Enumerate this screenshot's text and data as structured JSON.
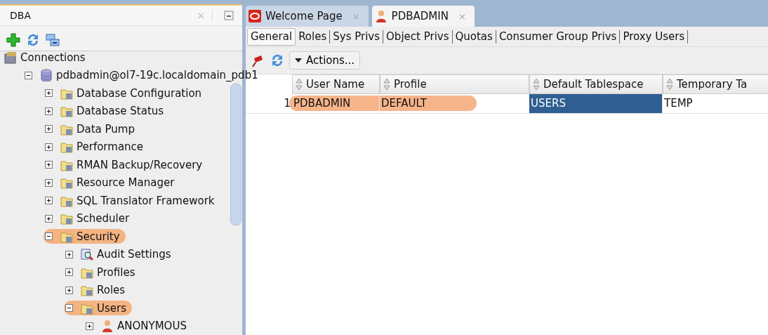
{
  "left_panel": {
    "title": "DBA",
    "close": "×",
    "tree": [
      {
        "label": "Connections",
        "kind": "connections",
        "children": [
          {
            "label": "pdbadmin@ol7-19c.localdomain_pdb1",
            "kind": "database",
            "expanded": true,
            "highlighted": false,
            "children": [
              {
                "label": "Database Configuration",
                "kind": "folder",
                "expanded": false,
                "highlighted": false
              },
              {
                "label": "Database Status",
                "kind": "folder",
                "expanded": false,
                "highlighted": false
              },
              {
                "label": "Data Pump",
                "kind": "folder",
                "expanded": false,
                "highlighted": false
              },
              {
                "label": "Performance",
                "kind": "folder",
                "expanded": false,
                "highlighted": false
              },
              {
                "label": "RMAN Backup/Recovery",
                "kind": "folder",
                "expanded": false,
                "highlighted": false
              },
              {
                "label": "Resource Manager",
                "kind": "folder",
                "expanded": false,
                "highlighted": false
              },
              {
                "label": "SQL Translator Framework",
                "kind": "folder",
                "expanded": false,
                "highlighted": false
              },
              {
                "label": "Scheduler",
                "kind": "folder",
                "expanded": false,
                "highlighted": false
              },
              {
                "label": "Security",
                "kind": "folder",
                "expanded": true,
                "highlighted": true,
                "children": [
                  {
                    "label": "Audit Settings",
                    "kind": "audit",
                    "expanded": false,
                    "highlighted": false
                  },
                  {
                    "label": "Profiles",
                    "kind": "folder",
                    "expanded": false,
                    "highlighted": false
                  },
                  {
                    "label": "Roles",
                    "kind": "folder",
                    "expanded": false,
                    "highlighted": false
                  },
                  {
                    "label": "Users",
                    "kind": "folder",
                    "expanded": true,
                    "highlighted": true,
                    "children": [
                      {
                        "label": "ANONYMOUS",
                        "kind": "user",
                        "expanded": false,
                        "highlighted": false
                      }
                    ]
                  }
                ]
              }
            ]
          }
        ]
      }
    ]
  },
  "editor": {
    "tabs": [
      {
        "label": "Welcome Page",
        "kind": "oracle",
        "close": "×",
        "selected": false
      },
      {
        "label": "PDBADMIN",
        "kind": "user",
        "close": "×",
        "selected": true
      }
    ],
    "subtabs": [
      {
        "label": "General",
        "selected": true
      },
      {
        "label": "Roles",
        "selected": false
      },
      {
        "label": "Sys Privs",
        "selected": false
      },
      {
        "label": "Object Privs",
        "selected": false
      },
      {
        "label": "Quotas",
        "selected": false
      },
      {
        "label": "Consumer Group Privs",
        "selected": false
      },
      {
        "label": "Proxy Users",
        "selected": false
      }
    ],
    "actions_button": "Actions...",
    "table": {
      "columns": [
        "User Name",
        "Profile",
        "Default Tablespace",
        "Temporary Ta"
      ],
      "rows": [
        {
          "number": "1",
          "highlighted": true,
          "cells": [
            {
              "text": "PDBADMIN",
              "selected": false
            },
            {
              "text": "DEFAULT",
              "selected": false
            },
            {
              "text": "USERS",
              "selected": true
            },
            {
              "text": "TEMP",
              "selected": false
            }
          ]
        }
      ]
    }
  }
}
